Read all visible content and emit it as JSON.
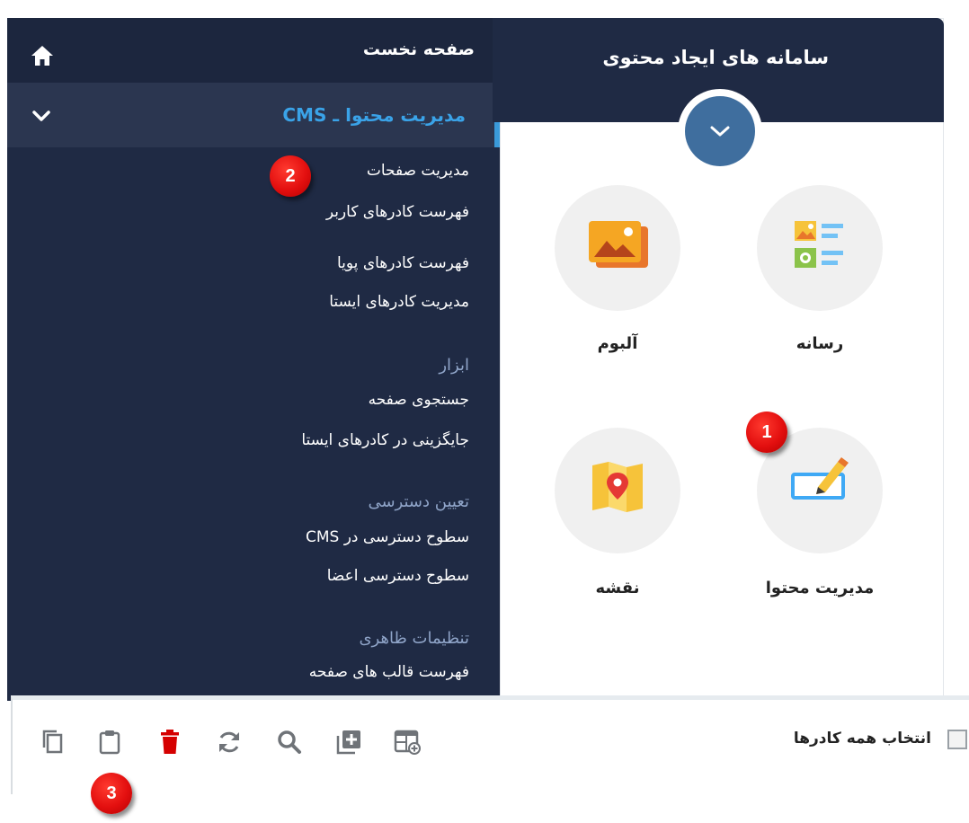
{
  "sidebar": {
    "home_label": "صفحه نخست",
    "cms_label": "مدیریت محتوا ـ CMS",
    "items": [
      "مدیریت صفحات",
      "فهرست کادرهای کاربر",
      "فهرست کادرهای پویا",
      "مدیریت کادرهای ایستا"
    ],
    "tools_heading": "ابزار",
    "tools_items": [
      "جستجوی صفحه",
      "جایگزینی در کادرهای ایستا"
    ],
    "access_heading": "تعیین دسترسی",
    "access_items": [
      "سطوح دسترسی در CMS",
      "سطوح دسترسی اعضا"
    ],
    "appearance_heading": "تنظیمات ظاهری",
    "appearance_items": [
      "فهرست قالب های صفحه"
    ]
  },
  "panel": {
    "title": "سامانه های ایجاد محتوی",
    "tiles": [
      {
        "label": "رسانه",
        "icon": "media-icon"
      },
      {
        "label": "آلبوم",
        "icon": "album-icon"
      },
      {
        "label": "مدیریت محتوا",
        "icon": "edit-content-icon"
      },
      {
        "label": "نقشه",
        "icon": "map-icon"
      }
    ]
  },
  "toolbar": {
    "select_all_label": "انتخاب همه کادرها",
    "icons": [
      "copy-icon",
      "paste-icon",
      "delete-icon",
      "refresh-icon",
      "search-icon",
      "add-icon",
      "add-box-icon"
    ]
  },
  "badges": [
    "1",
    "2",
    "3"
  ],
  "colors": {
    "nav_bg": "#1f2a44",
    "accent": "#3aa3e8",
    "badge_red": "#e30f0f",
    "delete_red": "#d50000"
  }
}
